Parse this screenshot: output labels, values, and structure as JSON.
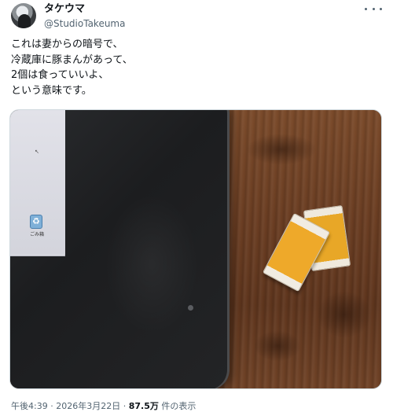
{
  "author": {
    "display_name": "タケウマ",
    "handle": "@StudioTakeuma"
  },
  "tweet": {
    "lines": [
      "これは妻からの暗号で、",
      "冷蔵庫に豚まんがあって、",
      "2個は食っていいよ、",
      "という意味です。"
    ]
  },
  "media": {
    "desktop_icon_label": "ごみ箱"
  },
  "meta": {
    "time": "午後4:39",
    "sep1": " · ",
    "date": "2026年3月22日",
    "sep2": " · ",
    "views_count": "87.5万",
    "views_label": " 件の表示"
  },
  "icons": {
    "more": "more-horizontal-icon",
    "recycle": "recycle-bin-icon"
  }
}
